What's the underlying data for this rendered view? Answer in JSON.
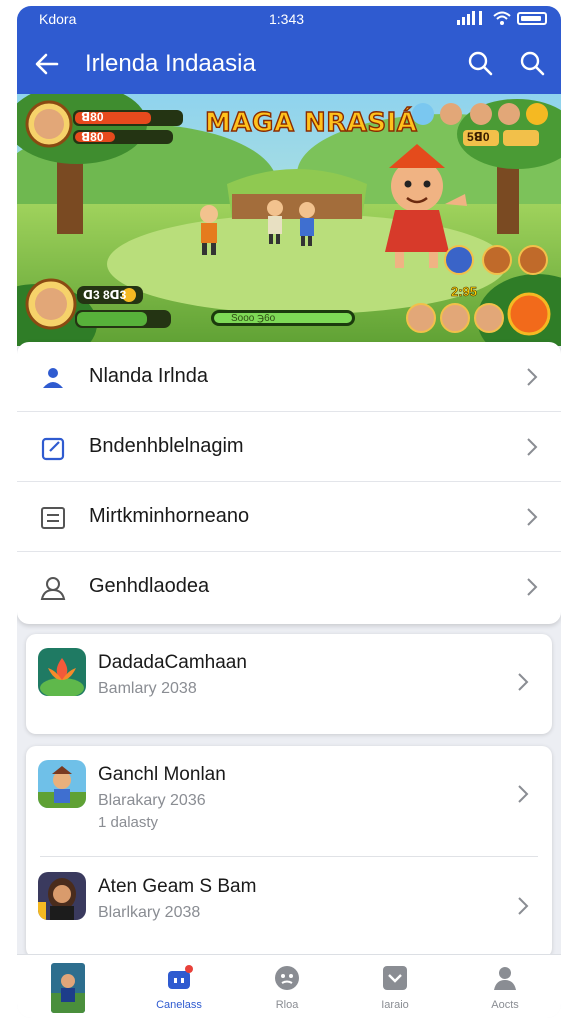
{
  "status_bar": {
    "carrier": "Kdora",
    "time": "1:343"
  },
  "app_bar": {
    "title": "Irlenda Indaasia",
    "back_icon": "arrow-left-icon",
    "icons": [
      "search-icon",
      "search-icon"
    ]
  },
  "banner": {
    "game_title": "MAGA NRASIÁ",
    "hud_top_left": "ꓭ80",
    "hud_top_left_2": "ꓭ80",
    "hud_score_top": "5ꓭ0",
    "hud_mid_left": "ꓷ3 8ꓷ3",
    "hud_score_bottom": "2:95",
    "hud_bottom_label": "Sooo ℈6o"
  },
  "menu": [
    {
      "icon": "person-icon",
      "label": "Nlanda Irlnda"
    },
    {
      "icon": "edit-icon",
      "label": "Bndenhblelnagim"
    },
    {
      "icon": "document-icon",
      "label": "Mirtkminhorneano"
    },
    {
      "icon": "user-outline-icon",
      "label": "Genhdlaodea"
    }
  ],
  "games_card_1": [
    {
      "name": "DadadaCamhaan",
      "sub": "Bamlary 2038",
      "sub2": ""
    }
  ],
  "games_card_2": [
    {
      "name": "Ganchl Monlan",
      "sub": "Blarakary 2036",
      "sub2": "1 dalasty"
    },
    {
      "name": "Aten Geam S Bam",
      "sub": "Blarlkary 2038",
      "sub2": ""
    }
  ],
  "bottom_nav": [
    {
      "icon": "game-thumb-icon",
      "label": ""
    },
    {
      "icon": "store-icon",
      "label": "Canelass"
    },
    {
      "icon": "globe-icon",
      "label": "Rloa"
    },
    {
      "icon": "chat-icon",
      "label": "Iaraio"
    },
    {
      "icon": "profile-icon",
      "label": "Aocts"
    }
  ],
  "colors": {
    "primary": "#2f5bd0",
    "game_title": "#ffc21c",
    "chevron": "#8a8d93"
  }
}
